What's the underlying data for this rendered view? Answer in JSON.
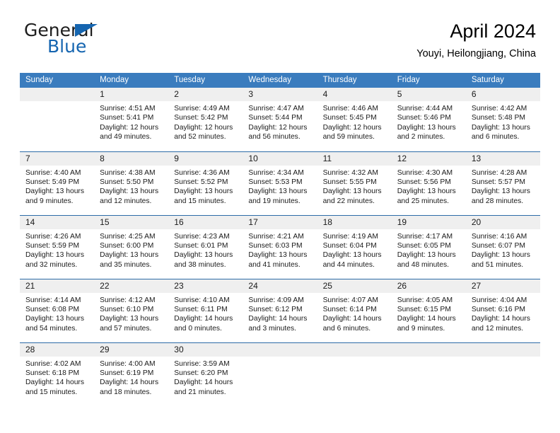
{
  "brand": {
    "word_one": "General",
    "word_two": "Blue",
    "flag_icon": "triangle-flag-icon",
    "accent_color": "#1565b0"
  },
  "header": {
    "title": "April 2024",
    "subtitle": "Youyi, Heilongjiang, China"
  },
  "calendar": {
    "header_bg": "#3a7cbe",
    "daynum_bg": "#efefef",
    "row_border": "#2d6ca8",
    "weekdays": [
      "Sunday",
      "Monday",
      "Tuesday",
      "Wednesday",
      "Thursday",
      "Friday",
      "Saturday"
    ],
    "weeks": [
      [
        {
          "day": "",
          "sunrise": "",
          "sunset": "",
          "daylight_line1": "",
          "daylight_line2": ""
        },
        {
          "day": "1",
          "sunrise": "Sunrise: 4:51 AM",
          "sunset": "Sunset: 5:41 PM",
          "daylight_line1": "Daylight: 12 hours",
          "daylight_line2": "and 49 minutes."
        },
        {
          "day": "2",
          "sunrise": "Sunrise: 4:49 AM",
          "sunset": "Sunset: 5:42 PM",
          "daylight_line1": "Daylight: 12 hours",
          "daylight_line2": "and 52 minutes."
        },
        {
          "day": "3",
          "sunrise": "Sunrise: 4:47 AM",
          "sunset": "Sunset: 5:44 PM",
          "daylight_line1": "Daylight: 12 hours",
          "daylight_line2": "and 56 minutes."
        },
        {
          "day": "4",
          "sunrise": "Sunrise: 4:46 AM",
          "sunset": "Sunset: 5:45 PM",
          "daylight_line1": "Daylight: 12 hours",
          "daylight_line2": "and 59 minutes."
        },
        {
          "day": "5",
          "sunrise": "Sunrise: 4:44 AM",
          "sunset": "Sunset: 5:46 PM",
          "daylight_line1": "Daylight: 13 hours",
          "daylight_line2": "and 2 minutes."
        },
        {
          "day": "6",
          "sunrise": "Sunrise: 4:42 AM",
          "sunset": "Sunset: 5:48 PM",
          "daylight_line1": "Daylight: 13 hours",
          "daylight_line2": "and 6 minutes."
        }
      ],
      [
        {
          "day": "7",
          "sunrise": "Sunrise: 4:40 AM",
          "sunset": "Sunset: 5:49 PM",
          "daylight_line1": "Daylight: 13 hours",
          "daylight_line2": "and 9 minutes."
        },
        {
          "day": "8",
          "sunrise": "Sunrise: 4:38 AM",
          "sunset": "Sunset: 5:50 PM",
          "daylight_line1": "Daylight: 13 hours",
          "daylight_line2": "and 12 minutes."
        },
        {
          "day": "9",
          "sunrise": "Sunrise: 4:36 AM",
          "sunset": "Sunset: 5:52 PM",
          "daylight_line1": "Daylight: 13 hours",
          "daylight_line2": "and 15 minutes."
        },
        {
          "day": "10",
          "sunrise": "Sunrise: 4:34 AM",
          "sunset": "Sunset: 5:53 PM",
          "daylight_line1": "Daylight: 13 hours",
          "daylight_line2": "and 19 minutes."
        },
        {
          "day": "11",
          "sunrise": "Sunrise: 4:32 AM",
          "sunset": "Sunset: 5:55 PM",
          "daylight_line1": "Daylight: 13 hours",
          "daylight_line2": "and 22 minutes."
        },
        {
          "day": "12",
          "sunrise": "Sunrise: 4:30 AM",
          "sunset": "Sunset: 5:56 PM",
          "daylight_line1": "Daylight: 13 hours",
          "daylight_line2": "and 25 minutes."
        },
        {
          "day": "13",
          "sunrise": "Sunrise: 4:28 AM",
          "sunset": "Sunset: 5:57 PM",
          "daylight_line1": "Daylight: 13 hours",
          "daylight_line2": "and 28 minutes."
        }
      ],
      [
        {
          "day": "14",
          "sunrise": "Sunrise: 4:26 AM",
          "sunset": "Sunset: 5:59 PM",
          "daylight_line1": "Daylight: 13 hours",
          "daylight_line2": "and 32 minutes."
        },
        {
          "day": "15",
          "sunrise": "Sunrise: 4:25 AM",
          "sunset": "Sunset: 6:00 PM",
          "daylight_line1": "Daylight: 13 hours",
          "daylight_line2": "and 35 minutes."
        },
        {
          "day": "16",
          "sunrise": "Sunrise: 4:23 AM",
          "sunset": "Sunset: 6:01 PM",
          "daylight_line1": "Daylight: 13 hours",
          "daylight_line2": "and 38 minutes."
        },
        {
          "day": "17",
          "sunrise": "Sunrise: 4:21 AM",
          "sunset": "Sunset: 6:03 PM",
          "daylight_line1": "Daylight: 13 hours",
          "daylight_line2": "and 41 minutes."
        },
        {
          "day": "18",
          "sunrise": "Sunrise: 4:19 AM",
          "sunset": "Sunset: 6:04 PM",
          "daylight_line1": "Daylight: 13 hours",
          "daylight_line2": "and 44 minutes."
        },
        {
          "day": "19",
          "sunrise": "Sunrise: 4:17 AM",
          "sunset": "Sunset: 6:05 PM",
          "daylight_line1": "Daylight: 13 hours",
          "daylight_line2": "and 48 minutes."
        },
        {
          "day": "20",
          "sunrise": "Sunrise: 4:16 AM",
          "sunset": "Sunset: 6:07 PM",
          "daylight_line1": "Daylight: 13 hours",
          "daylight_line2": "and 51 minutes."
        }
      ],
      [
        {
          "day": "21",
          "sunrise": "Sunrise: 4:14 AM",
          "sunset": "Sunset: 6:08 PM",
          "daylight_line1": "Daylight: 13 hours",
          "daylight_line2": "and 54 minutes."
        },
        {
          "day": "22",
          "sunrise": "Sunrise: 4:12 AM",
          "sunset": "Sunset: 6:10 PM",
          "daylight_line1": "Daylight: 13 hours",
          "daylight_line2": "and 57 minutes."
        },
        {
          "day": "23",
          "sunrise": "Sunrise: 4:10 AM",
          "sunset": "Sunset: 6:11 PM",
          "daylight_line1": "Daylight: 14 hours",
          "daylight_line2": "and 0 minutes."
        },
        {
          "day": "24",
          "sunrise": "Sunrise: 4:09 AM",
          "sunset": "Sunset: 6:12 PM",
          "daylight_line1": "Daylight: 14 hours",
          "daylight_line2": "and 3 minutes."
        },
        {
          "day": "25",
          "sunrise": "Sunrise: 4:07 AM",
          "sunset": "Sunset: 6:14 PM",
          "daylight_line1": "Daylight: 14 hours",
          "daylight_line2": "and 6 minutes."
        },
        {
          "day": "26",
          "sunrise": "Sunrise: 4:05 AM",
          "sunset": "Sunset: 6:15 PM",
          "daylight_line1": "Daylight: 14 hours",
          "daylight_line2": "and 9 minutes."
        },
        {
          "day": "27",
          "sunrise": "Sunrise: 4:04 AM",
          "sunset": "Sunset: 6:16 PM",
          "daylight_line1": "Daylight: 14 hours",
          "daylight_line2": "and 12 minutes."
        }
      ],
      [
        {
          "day": "28",
          "sunrise": "Sunrise: 4:02 AM",
          "sunset": "Sunset: 6:18 PM",
          "daylight_line1": "Daylight: 14 hours",
          "daylight_line2": "and 15 minutes."
        },
        {
          "day": "29",
          "sunrise": "Sunrise: 4:00 AM",
          "sunset": "Sunset: 6:19 PM",
          "daylight_line1": "Daylight: 14 hours",
          "daylight_line2": "and 18 minutes."
        },
        {
          "day": "30",
          "sunrise": "Sunrise: 3:59 AM",
          "sunset": "Sunset: 6:20 PM",
          "daylight_line1": "Daylight: 14 hours",
          "daylight_line2": "and 21 minutes."
        },
        {
          "day": "",
          "sunrise": "",
          "sunset": "",
          "daylight_line1": "",
          "daylight_line2": ""
        },
        {
          "day": "",
          "sunrise": "",
          "sunset": "",
          "daylight_line1": "",
          "daylight_line2": ""
        },
        {
          "day": "",
          "sunrise": "",
          "sunset": "",
          "daylight_line1": "",
          "daylight_line2": ""
        },
        {
          "day": "",
          "sunrise": "",
          "sunset": "",
          "daylight_line1": "",
          "daylight_line2": ""
        }
      ]
    ]
  }
}
